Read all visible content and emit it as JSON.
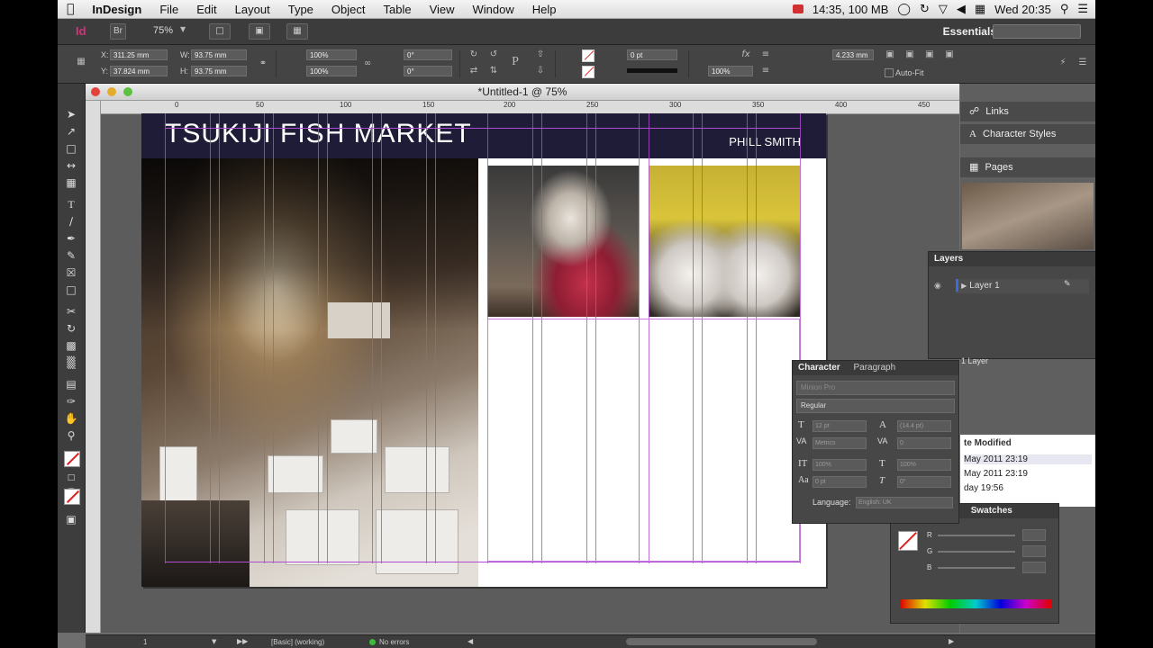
{
  "menubar": {
    "apple_icon": "apple-icon",
    "app_name": "InDesign",
    "items": [
      "File",
      "Edit",
      "Layout",
      "Type",
      "Object",
      "Table",
      "View",
      "Window",
      "Help"
    ],
    "status": "14:35, 100 MB",
    "clock": "Wed 20:35"
  },
  "appbar": {
    "logo": "Id",
    "bridge": "Br",
    "zoom": "75%",
    "workspace": "Essentials"
  },
  "control": {
    "x": "311.25 mm",
    "y": "37.824 mm",
    "w": "93.75 mm",
    "h": "93.75 mm",
    "scale_x": "100%",
    "scale_y": "100%",
    "rotate": "0°",
    "shear": "0°",
    "stroke": "0 pt",
    "opacity": "100%",
    "offset": "4.233 mm",
    "autofit": "Auto-Fit",
    "x_label": "X:",
    "y_label": "Y:",
    "w_label": "W:",
    "h_label": "H:"
  },
  "document": {
    "title": "*Untitled-1 @ 75%",
    "ruler_ticks": [
      "0",
      "50",
      "100",
      "150",
      "200",
      "250",
      "300",
      "350",
      "400",
      "450"
    ],
    "page_title": "TSUKIJI FISH MARKET",
    "author": "PHILL SMITH"
  },
  "dock": {
    "links": "Links",
    "character_styles": "Character Styles",
    "pages": "Pages",
    "layers_tab": "Layers",
    "layer_name": "Layer 1",
    "layer_count": "1 Layer",
    "date_header": "te Modified",
    "dates": [
      "May 2011 23:19",
      "May 2011 23:19",
      "day 19:56"
    ]
  },
  "character_panel": {
    "tab_character": "Character",
    "tab_paragraph": "Paragraph",
    "font": "Minion Pro",
    "style": "Regular",
    "size": "12 pt",
    "leading": "(14.4 pt)",
    "kerning": "Metrics",
    "tracking": "0",
    "v_scale": "100%",
    "h_scale": "100%",
    "baseline": "0 pt",
    "skew": "0°",
    "language_label": "Language:",
    "language": "English: UK"
  },
  "color_panel": {
    "tab_color": "r",
    "tab_swatches": "Swatches",
    "r": "R",
    "g": "G",
    "b": "B"
  },
  "statusbar": {
    "page": "1",
    "profile": "[Basic] (working)",
    "errors": "No errors"
  },
  "colors": {
    "banner": "#1e1c36",
    "guide": "#b04cd2",
    "error_ok": "#3dbb3d"
  }
}
